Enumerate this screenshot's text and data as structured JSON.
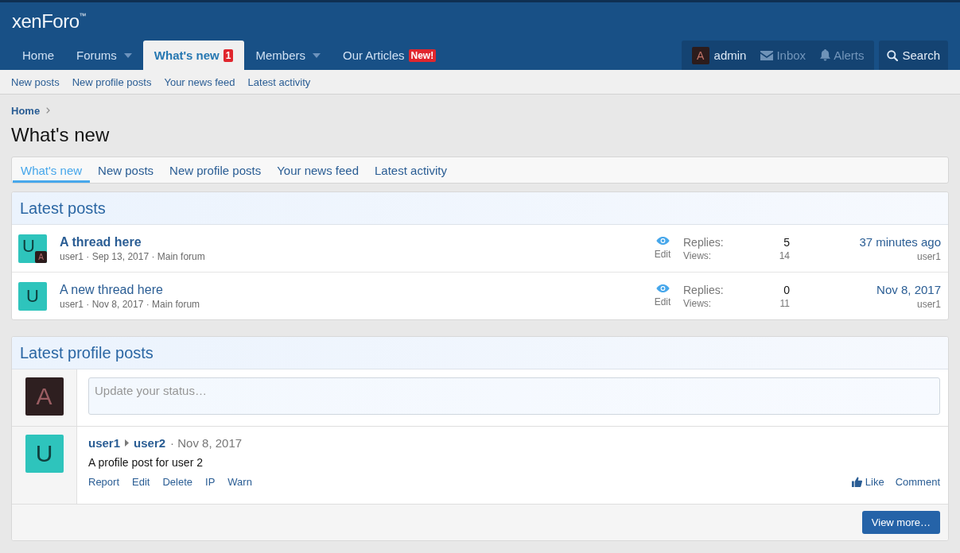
{
  "header": {
    "logo": "xenForo$^{™}$"
  },
  "nav": {
    "tabs": [
      {
        "label": "Home",
        "selected": false,
        "dropdown": false
      },
      {
        "label": "Forums",
        "selected": false,
        "dropdown": true
      },
      {
        "label": "What's new",
        "selected": true,
        "dropdown": false,
        "badge": "1"
      },
      {
        "label": "Members",
        "selected": false,
        "dropdown": true
      },
      {
        "label": "Our Articles",
        "selected": false,
        "dropdown": false,
        "badge": "New!"
      }
    ]
  },
  "user_nav": {
    "avatar": "A",
    "name": "admin",
    "items": [
      {
        "kind": "inbox",
        "label": "Inbox"
      },
      {
        "kind": "alerts",
        "label": "Alerts"
      }
    ],
    "search": "Search"
  },
  "sub_nav": [
    "New posts",
    "New profile posts",
    "Your news feed",
    "Latest activity"
  ],
  "breadcrumb": [
    "Home"
  ],
  "page_title": "What's new",
  "tabs": [
    {
      "label": "What's new",
      "selected": true
    },
    {
      "label": "New posts",
      "selected": false
    },
    {
      "label": "New profile posts",
      "selected": false
    },
    {
      "label": "Your news feed",
      "selected": false
    },
    {
      "label": "Latest activity",
      "selected": false
    }
  ],
  "latest_posts": {
    "title": "Latest posts",
    "threads": [
      {
        "avatar": "U",
        "last_poster_avatar": "A",
        "title": "A thread here",
        "unread": true,
        "meta": "user1 · Sep 13, 2017 · Main forum",
        "action": "Edit",
        "replies_label": "Replies:",
        "replies": "5",
        "views_label": "Views:",
        "views": "14",
        "last_date": "37 minutes ago",
        "last_user": "user1"
      },
      {
        "avatar": "U",
        "title": "A new thread here",
        "unread": false,
        "meta": "user1 · Nov 8, 2017 · Main forum",
        "action": "Edit",
        "replies_label": "Replies:",
        "replies": "0",
        "views_label": "Views:",
        "views": "11",
        "last_date": "Nov 8, 2017",
        "last_user": "user1"
      }
    ]
  },
  "profile_posts": {
    "title": "Latest profile posts",
    "status": {
      "avatar": "A",
      "placeholder": "Update your status…"
    },
    "posts": [
      {
        "avatar": "U",
        "author": "user1",
        "recipient": "user2",
        "date": "· Nov 8, 2017",
        "text": "A profile post for user 2",
        "actions": [
          "Report",
          "Edit",
          "Delete",
          "IP",
          "Warn"
        ],
        "like": "Like",
        "comment": "Comment"
      }
    ],
    "more_button": "View more…"
  }
}
